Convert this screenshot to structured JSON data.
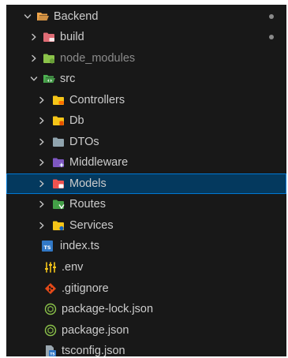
{
  "explorer": {
    "colors": {
      "background": "#181818",
      "selected_bg": "#04395e",
      "selected_border": "#0078d4",
      "text": "#cccccc",
      "dim_text": "#8b8b8b"
    },
    "rows": [
      {
        "label": "Backend",
        "icon": "folder-open-icon",
        "color": "#f0a54a",
        "chevron": "down",
        "modified": true
      },
      {
        "label": "build",
        "icon": "folder-build-icon",
        "color": "#e06c75",
        "chevron": "right",
        "modified": true
      },
      {
        "label": "node_modules",
        "icon": "folder-node-icon",
        "color": "#8bc34a",
        "chevron": "right",
        "dimmed": true
      },
      {
        "label": "src",
        "icon": "folder-src-open-icon",
        "color": "#4caf50",
        "chevron": "down"
      },
      {
        "label": "Controllers",
        "icon": "folder-controller-icon",
        "color": "#f5c518",
        "chevron": "right"
      },
      {
        "label": "Db",
        "icon": "folder-db-icon",
        "color": "#f5c518",
        "chevron": "right"
      },
      {
        "label": "DTOs",
        "icon": "folder-icon",
        "color": "#90a4ae",
        "chevron": "right"
      },
      {
        "label": "Middleware",
        "icon": "folder-middleware-icon",
        "color": "#7e57c2",
        "chevron": "right"
      },
      {
        "label": "Models",
        "icon": "folder-models-icon",
        "color": "#ef5350",
        "chevron": "right",
        "selected": true
      },
      {
        "label": "Routes",
        "icon": "folder-routes-icon",
        "color": "#43a047",
        "chevron": "right"
      },
      {
        "label": "Services",
        "icon": "folder-services-icon",
        "color": "#f5c518",
        "chevron": "right"
      },
      {
        "label": "index.ts",
        "icon": "typescript-file-icon",
        "color": "#3178c6",
        "badge": "TS"
      },
      {
        "label": ".env",
        "icon": "env-file-icon",
        "color": "#f5c518"
      },
      {
        "label": ".gitignore",
        "icon": "git-icon",
        "color": "#e64a19"
      },
      {
        "label": "package-lock.json",
        "icon": "npm-package-icon",
        "color": "#8bc34a"
      },
      {
        "label": "package.json",
        "icon": "npm-package-icon",
        "color": "#8bc34a"
      },
      {
        "label": "tsconfig.json",
        "icon": "tsconfig-file-icon",
        "color": "#3178c6"
      }
    ]
  }
}
